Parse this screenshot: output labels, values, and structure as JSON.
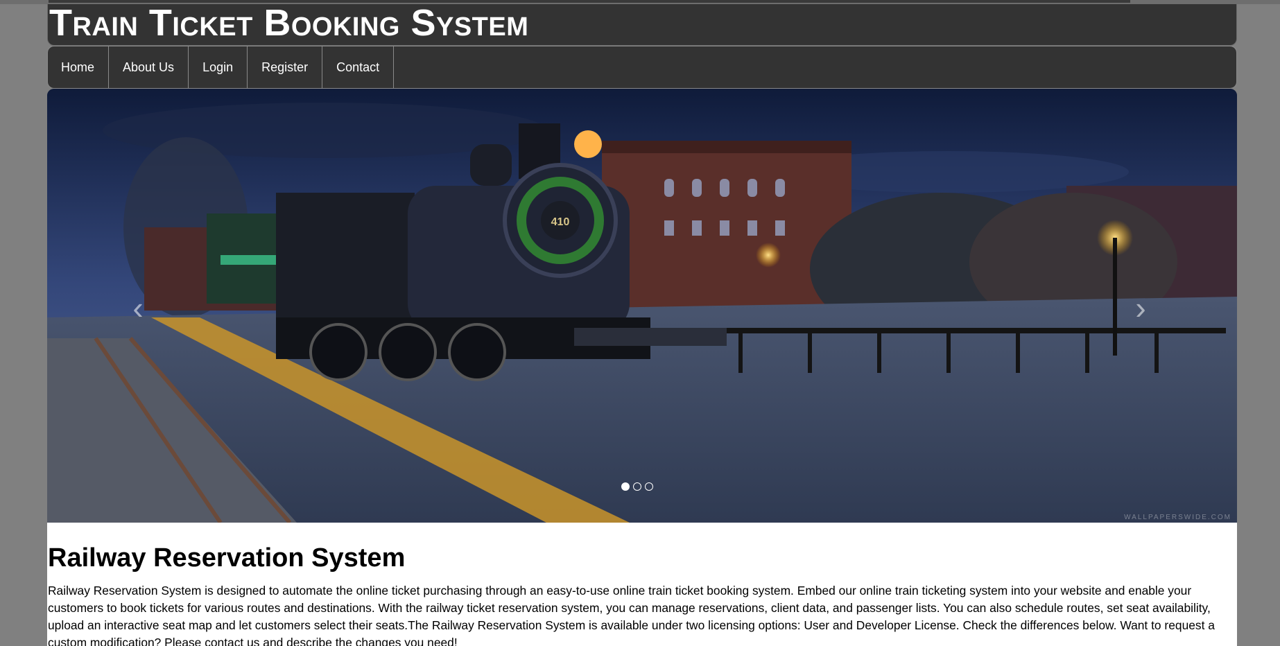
{
  "header": {
    "title": "Train Ticket Booking System"
  },
  "nav": {
    "items": [
      {
        "label": "Home"
      },
      {
        "label": "About Us"
      },
      {
        "label": "Login"
      },
      {
        "label": "Register"
      },
      {
        "label": "Contact"
      }
    ]
  },
  "slider": {
    "prev_icon": "chevron-left-icon",
    "next_icon": "chevron-right-icon",
    "arrow_prev": "‹",
    "arrow_next": "›",
    "slide_count": 3,
    "active_slide": 1,
    "watermark": "WALLPAPERSWIDE.COM",
    "locomotive_number": "410"
  },
  "main": {
    "heading": "Railway Reservation System",
    "body": "Railway Reservation System is designed to automate the online ticket purchasing through an easy-to-use online train ticket booking system. Embed our online train ticketing system into your website and enable your customers to book tickets for various routes and destinations. With the railway ticket reservation system, you can manage reservations, client data, and passenger lists. You can also schedule routes, set seat availability, upload an interactive seat map and let customers select their seats.The Railway Reservation System is available under two licensing options: User and Developer License. Check the differences below. Want to request a custom modification? Please contact us and describe the changes you need!"
  },
  "colors": {
    "page_bg": "#808080",
    "bar_bg": "#333333",
    "text_light": "#ffffff",
    "content_bg": "#ffffff"
  }
}
